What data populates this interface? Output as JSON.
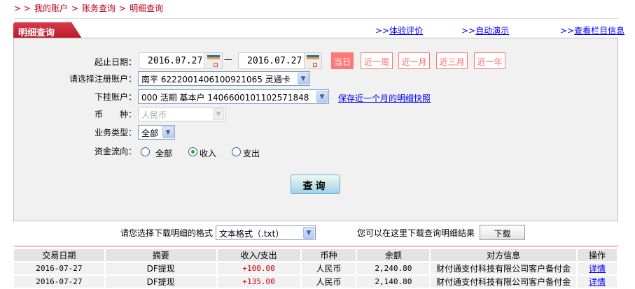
{
  "breadcrumb": {
    "prefix": "> >",
    "items": [
      "我的账户",
      "账务查询",
      "明细查询"
    ],
    "sep": ">"
  },
  "tab": {
    "title": "明细查询"
  },
  "top_links": [
    {
      "prefix": ">>",
      "label": "体验评价"
    },
    {
      "prefix": ">>",
      "label": "自动演示"
    },
    {
      "prefix": ">>",
      "label": "查看栏目信息"
    }
  ],
  "form": {
    "date_label": "起止日期：",
    "start_date": "2016.07.27",
    "end_date": "2016.07.27",
    "dash": "—",
    "quick_ranges": [
      {
        "label": "当日",
        "active": true
      },
      {
        "label": "近一周"
      },
      {
        "label": "近一月"
      },
      {
        "label": "近三月"
      },
      {
        "label": "近一年"
      }
    ],
    "account_label": "请选择注册账户：",
    "account_value": "南平 6222001406100921065 灵通卡",
    "sub_account_label": "下挂账户：",
    "sub_account_value": "000 活期 基本户 1406600101102571848",
    "snapshot_link": "保存近一个月的明细快照",
    "currency_label": "币　　种：",
    "currency_value": "人民币",
    "type_label": "业务类型：",
    "type_value": "全部",
    "flow_label": "资金流向：",
    "flow_options": [
      {
        "label": "全部",
        "checked": false
      },
      {
        "label": "收入",
        "checked": true
      },
      {
        "label": "支出",
        "checked": false
      }
    ],
    "query_button": "查询"
  },
  "download": {
    "format_label": "请您选择下载明细的格式",
    "format_value": "文本格式（.txt）",
    "hint": "您可以在这里下载查询明细结果",
    "button": "下载"
  },
  "table": {
    "headers": [
      "交易日期",
      "摘要",
      "收入/支出",
      "币种",
      "余额",
      "对方信息",
      "操作"
    ],
    "rows": [
      [
        "2016-07-27",
        "DF提现",
        "+100.00",
        "人民币",
        "2,240.80",
        "财付通支付科技有限公司客户备付金",
        "详情"
      ],
      [
        "2016-07-27",
        "DF提现",
        "+135.00",
        "人民币",
        "2,140.80",
        "财付通支付科技有限公司客户备付金",
        "详情"
      ]
    ]
  },
  "colors": {
    "brand_red": "#b8001f",
    "quick_button": "#ff7777",
    "link": "#0000ff"
  }
}
